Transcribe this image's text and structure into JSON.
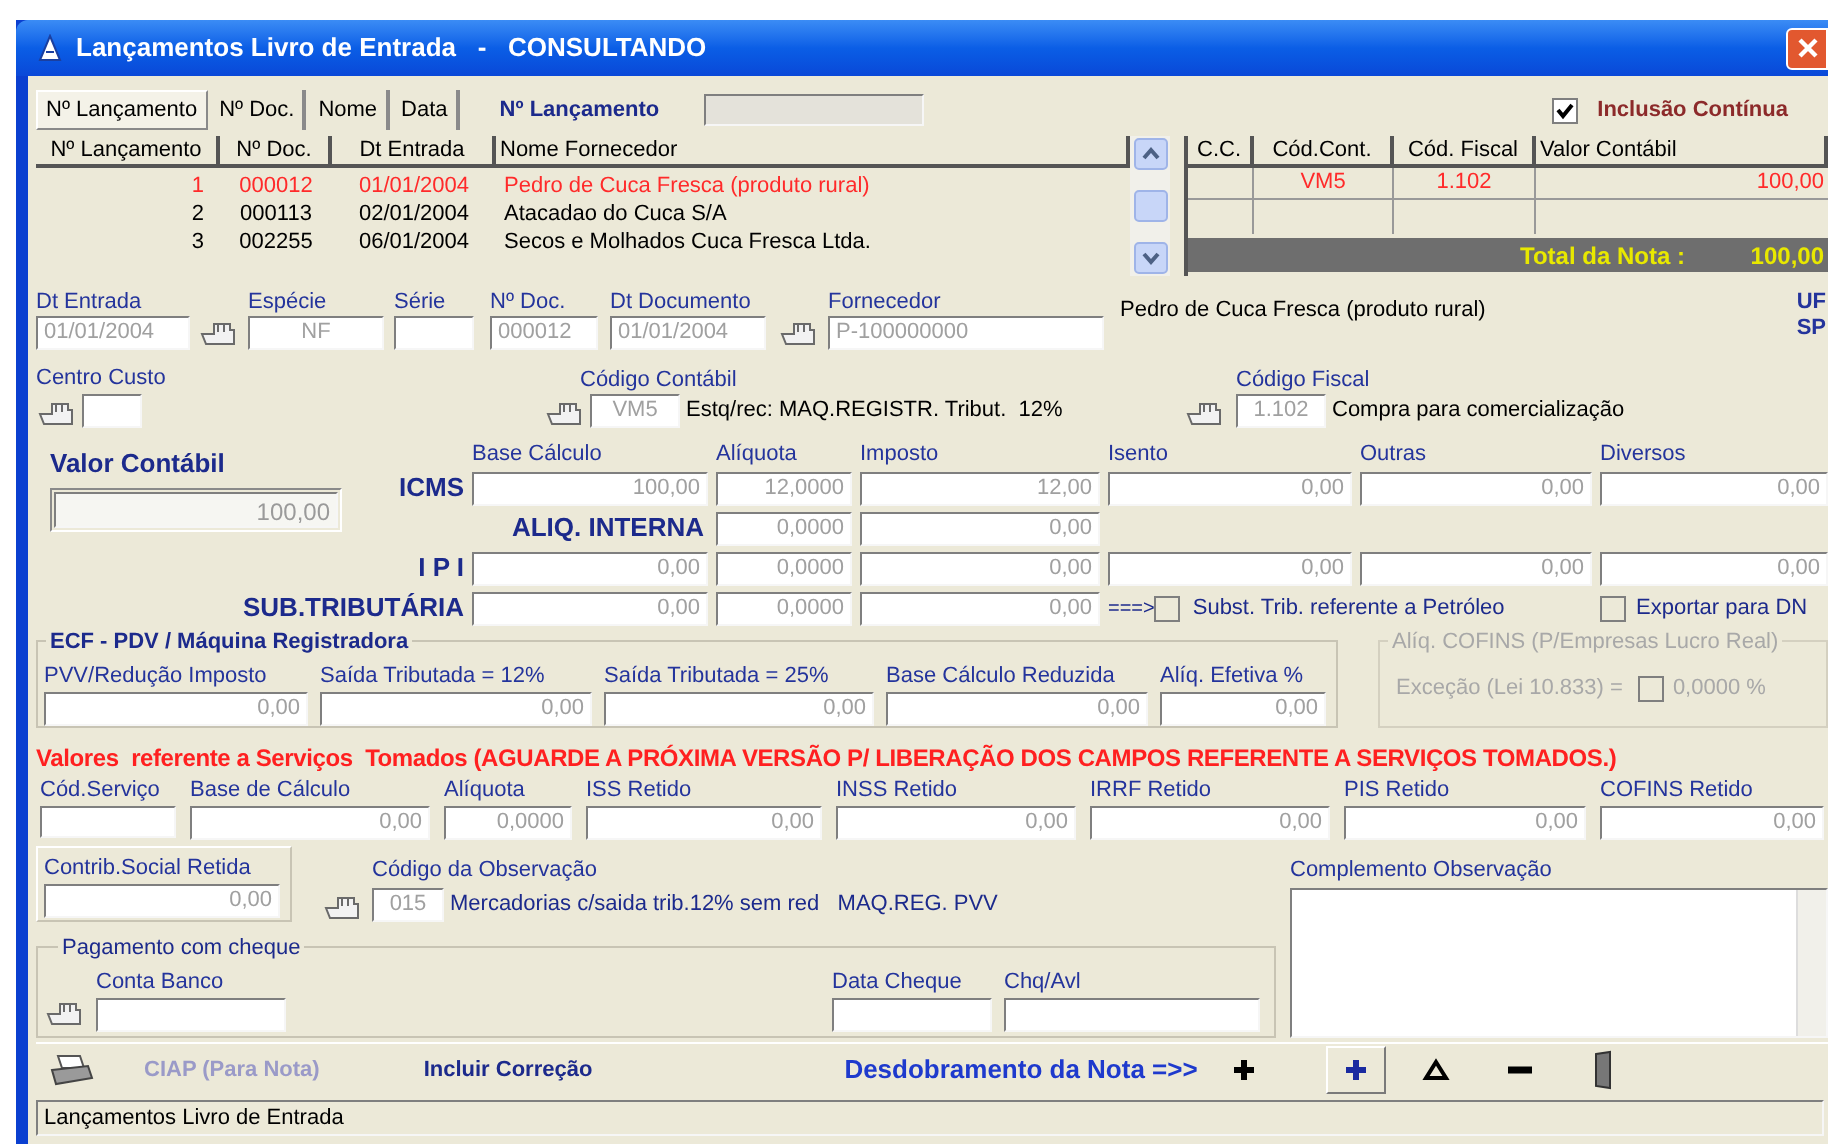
{
  "window": {
    "title": "Lançamentos Livro de Entrada   -   CONSULTANDO"
  },
  "search_tabs": [
    {
      "label": "Nº Lançamento",
      "selected": true
    },
    {
      "label": "Nº Doc.",
      "selected": false
    },
    {
      "label": "Nome",
      "selected": false
    },
    {
      "label": "Data",
      "selected": false
    }
  ],
  "search": {
    "label": "Nº Lançamento"
  },
  "continuous_entry": {
    "label": "Inclusão Contínua",
    "checked": true
  },
  "entries_table": {
    "columns": [
      "Nº Lançamento",
      "Nº Doc.",
      "Dt Entrada",
      "Nome Fornecedor"
    ],
    "rows": [
      {
        "cells": [
          "1",
          "000012",
          "01/01/2004",
          "Pedro de Cuca Fresca (produto rural)"
        ],
        "selected": true
      },
      {
        "cells": [
          "2",
          "000113",
          "02/01/2004",
          "Atacadao do Cuca S/A"
        ],
        "selected": false
      },
      {
        "cells": [
          "3",
          "002255",
          "06/01/2004",
          "Secos e Molhados Cuca Fresca Ltda."
        ],
        "selected": false
      }
    ]
  },
  "items_table": {
    "columns": [
      "C.C.",
      "Cód.Cont.",
      "Cód. Fiscal",
      "Valor Contábil"
    ],
    "rows": [
      {
        "cod_cont": "VM5",
        "cod_fiscal": "1.102",
        "valor": "100,00"
      }
    ],
    "total_label": "Total da Nota :",
    "total": "100,00"
  },
  "header_fields": [
    {
      "label": "Dt Entrada",
      "value": "01/01/2004"
    },
    {
      "label": "Espécie",
      "value": "NF"
    },
    {
      "label": "Série"
    },
    {
      "label": "Nº Doc.",
      "value": "000012"
    },
    {
      "label": "Dt Documento",
      "value": "01/01/2004"
    },
    {
      "label": "Fornecedor",
      "value": "P-100000000"
    }
  ],
  "supplier_name": "Pedro de Cuca Fresca (produto rural)",
  "uf": {
    "label": "UF",
    "value": "SP"
  },
  "centro_custo": {
    "label": "Centro Custo"
  },
  "codigo_contabil": {
    "label": "Código Contábil",
    "value": "VM5",
    "description": "Estq/rec: MAQ.REGISTR. Tribut.  12%"
  },
  "codigo_fiscal": {
    "label": "Código Fiscal",
    "value": "1.102",
    "description": "Compra para comercialização"
  },
  "valor_contabil": {
    "label": "Valor Contábil",
    "value": "100,00"
  },
  "tax_columns": [
    "Base Cálculo",
    "Alíquota",
    "Imposto",
    "Isento",
    "Outras",
    "Diversos"
  ],
  "tax_rows": [
    {
      "label": "ICMS",
      "kind": "full",
      "values": [
        "100,00",
        "12,0000",
        "12,00",
        "0,00",
        "0,00",
        "0,00"
      ]
    },
    {
      "inline_title": "ALIQ. INTERNA",
      "kind": "rate_only",
      "values": [
        "0,0000",
        "0,00"
      ]
    },
    {
      "label": "I P I",
      "kind": "full",
      "values": [
        "0,00",
        "0,0000",
        "0,00",
        "0,00",
        "0,00",
        "0,00"
      ]
    },
    {
      "label": "SUB.TRIBUTÁRIA",
      "kind": "substitution",
      "values": [
        "0,00",
        "0,0000",
        "0,00"
      ]
    }
  ],
  "substitution": {
    "arrow": "===>",
    "petroleum": {
      "label": "Subst. Trib. referente a Petróleo",
      "checked": false
    },
    "export": {
      "label": "Exportar para DN",
      "checked": false
    }
  },
  "ecf": {
    "title": "ECF - PDV / Máquina Registradora",
    "fields": [
      {
        "label": "PVV/Redução Imposto",
        "value": "0,00"
      },
      {
        "label": "Saída Tributada = 12%",
        "value": "0,00"
      },
      {
        "label": "Saída Tributada = 25%",
        "value": "0,00"
      },
      {
        "label": "Base Cálculo Reduzida",
        "value": "0,00"
      },
      {
        "label": "Alíq. Efetiva %",
        "value": "0,00"
      }
    ]
  },
  "cofins": {
    "title": "Alíq. COFINS (P/Empresas Lucro Real)",
    "disabled": true,
    "label": "Exceção (Lei 10.833) =",
    "checked": false,
    "value": "0,0000 %"
  },
  "services": {
    "heading": "Valores  referente a Serviços  Tomados (AGUARDE A PRÓXIMA VERSÃO P/ LIBERAÇÃO DOS CAMPOS REFERENTE A SERVIÇOS TOMADOS.)",
    "fields": [
      {
        "label": "Cód.Serviço"
      },
      {
        "label": "Base de Cálculo",
        "value": "0,00"
      },
      {
        "label": "Alíquota",
        "value": "0,0000"
      },
      {
        "label": "ISS Retido",
        "value": "0,00"
      },
      {
        "label": "INSS Retido",
        "value": "0,00"
      },
      {
        "label": "IRRF Retido",
        "value": "0,00"
      },
      {
        "label": "PIS Retido",
        "value": "0,00"
      },
      {
        "label": "COFINS Retido",
        "value": "0,00"
      }
    ]
  },
  "contrib": {
    "label": "Contrib.Social Retida",
    "value": "0,00"
  },
  "observation": {
    "label": "Código da Observação",
    "value": "015",
    "description": "Mercadorias c/saida trib.12% sem red   MAQ.REG. PVV"
  },
  "complement": {
    "label": "Complemento Observação"
  },
  "cheque": {
    "title": "Pagamento com cheque",
    "fields": [
      {
        "label": "Conta  Banco"
      },
      {
        "label": "Data Cheque"
      },
      {
        "label": "Chq/Avl"
      }
    ]
  },
  "toolbar": {
    "buttons": [
      {
        "label": "CIAP (Para Nota)",
        "disabled": true
      },
      {
        "label": "Incluir Correção",
        "disabled": false
      }
    ],
    "split_label": "Desdobramento da Nota =>>"
  },
  "status_bar": "Lançamentos Livro de Entrada"
}
